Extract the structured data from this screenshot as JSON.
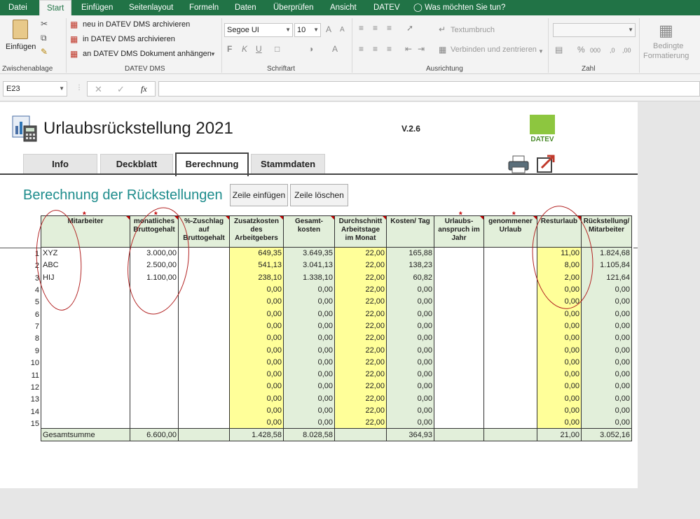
{
  "menu": {
    "tabs": [
      "Datei",
      "Start",
      "Einfügen",
      "Seitenlayout",
      "Formeln",
      "Daten",
      "Überprüfen",
      "Ansicht",
      "DATEV"
    ],
    "tell_me": "Was möchten Sie tun?",
    "accent": "#217346"
  },
  "ribbon": {
    "paste_label": "Einfügen",
    "clipboard_label": "Zwischenablage",
    "datev_dms": {
      "items": [
        "neu in DATEV DMS archivieren",
        "in DATEV DMS archivieren",
        "an DATEV DMS Dokument anhängen"
      ],
      "label": "DATEV DMS"
    },
    "font": {
      "name": "Segoe UI",
      "size": "10",
      "label": "Schriftart",
      "bold": "F",
      "italic": "K",
      "underline": "U"
    },
    "alignment": {
      "wrap": "Textumbruch",
      "merge": "Verbinden und zentrieren",
      "label": "Ausrichtung"
    },
    "number": {
      "label": "Zahl",
      "percent": "%",
      "thousands": "000"
    },
    "styles": {
      "conditional": "Bedingte",
      "conditional2": "Formatierung"
    }
  },
  "formula_bar": {
    "name_box": "E23",
    "fx": "fx",
    "value": ""
  },
  "sheet": {
    "title": "Urlaubsrückstellung 2021",
    "version": "V.2.6",
    "datev_logo": "DATEV",
    "tabs": [
      "Info",
      "Deckblatt",
      "Berechnung",
      "Stammdaten"
    ],
    "active_tab": "Berechnung",
    "heading": "Berechnung der Rückstellungen",
    "btn_insert": "Zeile einfügen",
    "btn_delete": "Zeile löschen",
    "star": "*",
    "columns": [
      "Mitarbeiter",
      "monatliches Bruttogehalt",
      "%-Zuschlag auf Bruttogehalt",
      "Zusatzkosten des Arbeitgebers",
      "Gesamt-kosten",
      "Durchschnitt Arbeitstage im Monat",
      "Kosten/ Tag",
      "Urlaubs-anspruch im Jahr",
      "genommener Urlaub",
      "Resturlaub",
      "Rückstellung/ Mitarbeiter"
    ],
    "rows": [
      [
        "XYZ",
        "3.000,00",
        "",
        "649,35",
        "3.649,35",
        "22,00",
        "165,88",
        "",
        "",
        "11,00",
        "1.824,68"
      ],
      [
        "ABC",
        "2.500,00",
        "",
        "541,13",
        "3.041,13",
        "22,00",
        "138,23",
        "",
        "",
        "8,00",
        "1.105,84"
      ],
      [
        "HIJ",
        "1.100,00",
        "",
        "238,10",
        "1.338,10",
        "22,00",
        "60,82",
        "",
        "",
        "2,00",
        "121,64"
      ],
      [
        "",
        "",
        "",
        "0,00",
        "0,00",
        "22,00",
        "0,00",
        "",
        "",
        "0,00",
        "0,00"
      ],
      [
        "",
        "",
        "",
        "0,00",
        "0,00",
        "22,00",
        "0,00",
        "",
        "",
        "0,00",
        "0,00"
      ],
      [
        "",
        "",
        "",
        "0,00",
        "0,00",
        "22,00",
        "0,00",
        "",
        "",
        "0,00",
        "0,00"
      ],
      [
        "",
        "",
        "",
        "0,00",
        "0,00",
        "22,00",
        "0,00",
        "",
        "",
        "0,00",
        "0,00"
      ],
      [
        "",
        "",
        "",
        "0,00",
        "0,00",
        "22,00",
        "0,00",
        "",
        "",
        "0,00",
        "0,00"
      ],
      [
        "",
        "",
        "",
        "0,00",
        "0,00",
        "22,00",
        "0,00",
        "",
        "",
        "0,00",
        "0,00"
      ],
      [
        "",
        "",
        "",
        "0,00",
        "0,00",
        "22,00",
        "0,00",
        "",
        "",
        "0,00",
        "0,00"
      ],
      [
        "",
        "",
        "",
        "0,00",
        "0,00",
        "22,00",
        "0,00",
        "",
        "",
        "0,00",
        "0,00"
      ],
      [
        "",
        "",
        "",
        "0,00",
        "0,00",
        "22,00",
        "0,00",
        "",
        "",
        "0,00",
        "0,00"
      ],
      [
        "",
        "",
        "",
        "0,00",
        "0,00",
        "22,00",
        "0,00",
        "",
        "",
        "0,00",
        "0,00"
      ],
      [
        "",
        "",
        "",
        "0,00",
        "0,00",
        "22,00",
        "0,00",
        "",
        "",
        "0,00",
        "0,00"
      ],
      [
        "",
        "",
        "",
        "0,00",
        "0,00",
        "22,00",
        "0,00",
        "",
        "",
        "0,00",
        "0,00"
      ]
    ],
    "row_numbers": [
      "1",
      "2",
      "3",
      "4",
      "5",
      "6",
      "7",
      "8",
      "9",
      "10",
      "11",
      "12",
      "13",
      "14",
      "15"
    ],
    "totals": [
      "Gesamtsumme",
      "6.600,00",
      "",
      "1.428,58",
      "8.028,58",
      "",
      "364,93",
      "",
      "",
      "21,00",
      "3.052,16"
    ],
    "colors": {
      "heading": "#1d8c8c",
      "input_yellow": "#ffff99",
      "calc_green": "#e2efda",
      "annotation": "#b22222"
    }
  }
}
